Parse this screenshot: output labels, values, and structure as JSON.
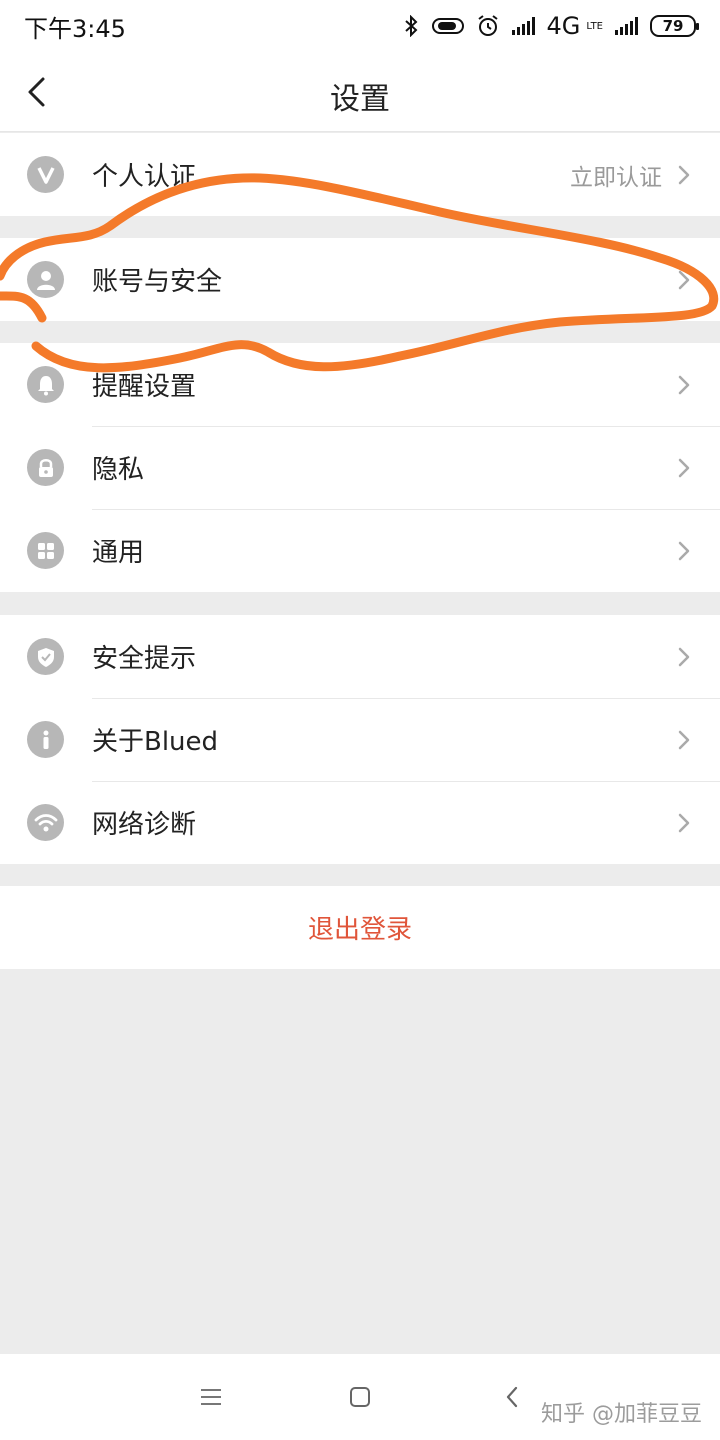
{
  "status_bar": {
    "time": "下午3:45",
    "network": "4G",
    "network_sub": "LTE",
    "battery": "79"
  },
  "header": {
    "title": "设置"
  },
  "groups": [
    {
      "items": [
        {
          "label": "个人认证",
          "value": "立即认证",
          "icon": "verified-v-icon"
        }
      ]
    },
    {
      "items": [
        {
          "label": "账号与安全",
          "icon": "user-icon"
        }
      ]
    },
    {
      "items": [
        {
          "label": "提醒设置",
          "icon": "bell-icon"
        },
        {
          "label": "隐私",
          "icon": "lock-icon"
        },
        {
          "label": "通用",
          "icon": "grid-icon"
        }
      ]
    },
    {
      "items": [
        {
          "label": "安全提示",
          "icon": "shield-icon"
        },
        {
          "label": "关于Blued",
          "icon": "info-icon"
        },
        {
          "label": "网络诊断",
          "icon": "wifi-icon"
        }
      ]
    }
  ],
  "logout": {
    "label": "退出登录"
  },
  "watermark": "知乎 @加菲豆豆",
  "colors": {
    "icon_bg": "#b7b7b7",
    "logout_text": "#e0553a",
    "annotation_stroke": "#f47a2a",
    "page_bg": "#ececec"
  }
}
